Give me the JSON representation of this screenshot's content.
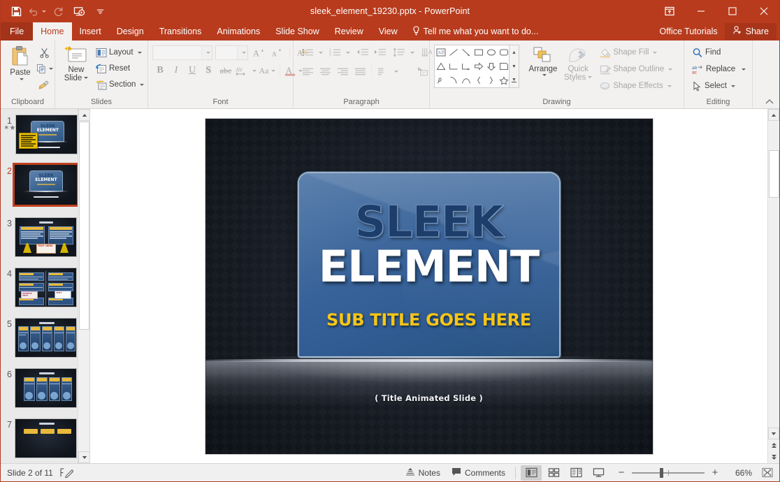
{
  "titlebar": {
    "document_title": "sleek_element_19230.pptx - PowerPoint",
    "qat": [
      {
        "name": "save-icon",
        "label": "Save"
      },
      {
        "name": "undo-icon",
        "label": "Undo"
      },
      {
        "name": "redo-icon",
        "label": "Redo"
      },
      {
        "name": "start-from-beginning-icon",
        "label": "Start From Beginning"
      },
      {
        "name": "customize-qat-icon",
        "label": "Customize Quick Access Toolbar"
      }
    ],
    "window": {
      "ribbon_display_options": "Ribbon Display Options",
      "minimize": "Minimize",
      "restore": "Restore Down",
      "close": "Close"
    }
  },
  "tabs": {
    "items": [
      {
        "label": "File",
        "active": false
      },
      {
        "label": "Home",
        "active": true
      },
      {
        "label": "Insert",
        "active": false
      },
      {
        "label": "Design",
        "active": false
      },
      {
        "label": "Transitions",
        "active": false
      },
      {
        "label": "Animations",
        "active": false
      },
      {
        "label": "Slide Show",
        "active": false
      },
      {
        "label": "Review",
        "active": false
      },
      {
        "label": "View",
        "active": false
      }
    ],
    "tell_me": "Tell me what you want to do...",
    "office_tutorials": "Office Tutorials",
    "share": "Share"
  },
  "ribbon": {
    "groups": [
      {
        "name": "Clipboard"
      },
      {
        "name": "Slides"
      },
      {
        "name": "Font"
      },
      {
        "name": "Paragraph"
      },
      {
        "name": "Drawing"
      },
      {
        "name": "Editing"
      }
    ],
    "clipboard": {
      "paste": "Paste",
      "cut": "Cut",
      "copy": "Copy",
      "format_painter": "Format Painter"
    },
    "slides": {
      "new_slide": "New",
      "new_slide2": "Slide",
      "layout": "Layout",
      "reset": "Reset",
      "section": "Section"
    },
    "font": {
      "font_name": "",
      "font_size": "",
      "grow_font": "A",
      "shrink_font": "A",
      "clear_formatting": "Clear All Formatting",
      "bold": "B",
      "italic": "I",
      "underline": "U",
      "shadow": "S",
      "strikethrough": "abc",
      "character_spacing": "AV",
      "change_case": "Aa",
      "font_color": "A"
    },
    "drawing": {
      "arrange": "Arrange",
      "quick_styles1": "Quick",
      "quick_styles2": "Styles",
      "shape_fill": "Shape Fill",
      "shape_outline": "Shape Outline",
      "shape_effects": "Shape Effects"
    },
    "editing": {
      "find": "Find",
      "replace": "Replace",
      "select": "Select"
    },
    "collapse": "Collapse the Ribbon"
  },
  "thumbnails": {
    "slides": [
      {
        "number": "1",
        "selected": false,
        "has_animation": true,
        "variant": "title-note"
      },
      {
        "number": "2",
        "selected": true,
        "has_animation": false,
        "variant": "title"
      },
      {
        "number": "3",
        "selected": false,
        "has_animation": false,
        "variant": "two-panel"
      },
      {
        "number": "4",
        "selected": false,
        "has_animation": false,
        "variant": "six-panel"
      },
      {
        "number": "5",
        "selected": false,
        "has_animation": false,
        "variant": "five-col"
      },
      {
        "number": "6",
        "selected": false,
        "has_animation": false,
        "variant": "four-col"
      },
      {
        "number": "7",
        "selected": false,
        "has_animation": false,
        "variant": "three-col"
      }
    ]
  },
  "slide": {
    "title_line1": "SLEEK",
    "title_line2": "ELEMENT",
    "subtitle": "SUB TITLE GOES HERE",
    "caption": "( Title Animated Slide )",
    "colors": {
      "background": "#161b24",
      "panel_blue": "#38639a",
      "title_blue": "#1d3e6b",
      "title_white": "#ffffff",
      "subtitle_yellow": "#f5c518"
    }
  },
  "status": {
    "slide_indicator": "Slide 2 of 11",
    "spelling_icon": "spell-check-icon",
    "notes": "Notes",
    "comments": "Comments",
    "views": [
      {
        "name": "normal-view",
        "label": "Normal",
        "active": true
      },
      {
        "name": "slide-sorter-view",
        "label": "Slide Sorter",
        "active": false
      },
      {
        "name": "reading-view",
        "label": "Reading View",
        "active": false
      },
      {
        "name": "slide-show-view",
        "label": "Slide Show",
        "active": false
      }
    ],
    "zoom_out": "−",
    "zoom_in": "+",
    "zoom_level": "66%",
    "fit_to_window": "Fit slide to current window"
  }
}
